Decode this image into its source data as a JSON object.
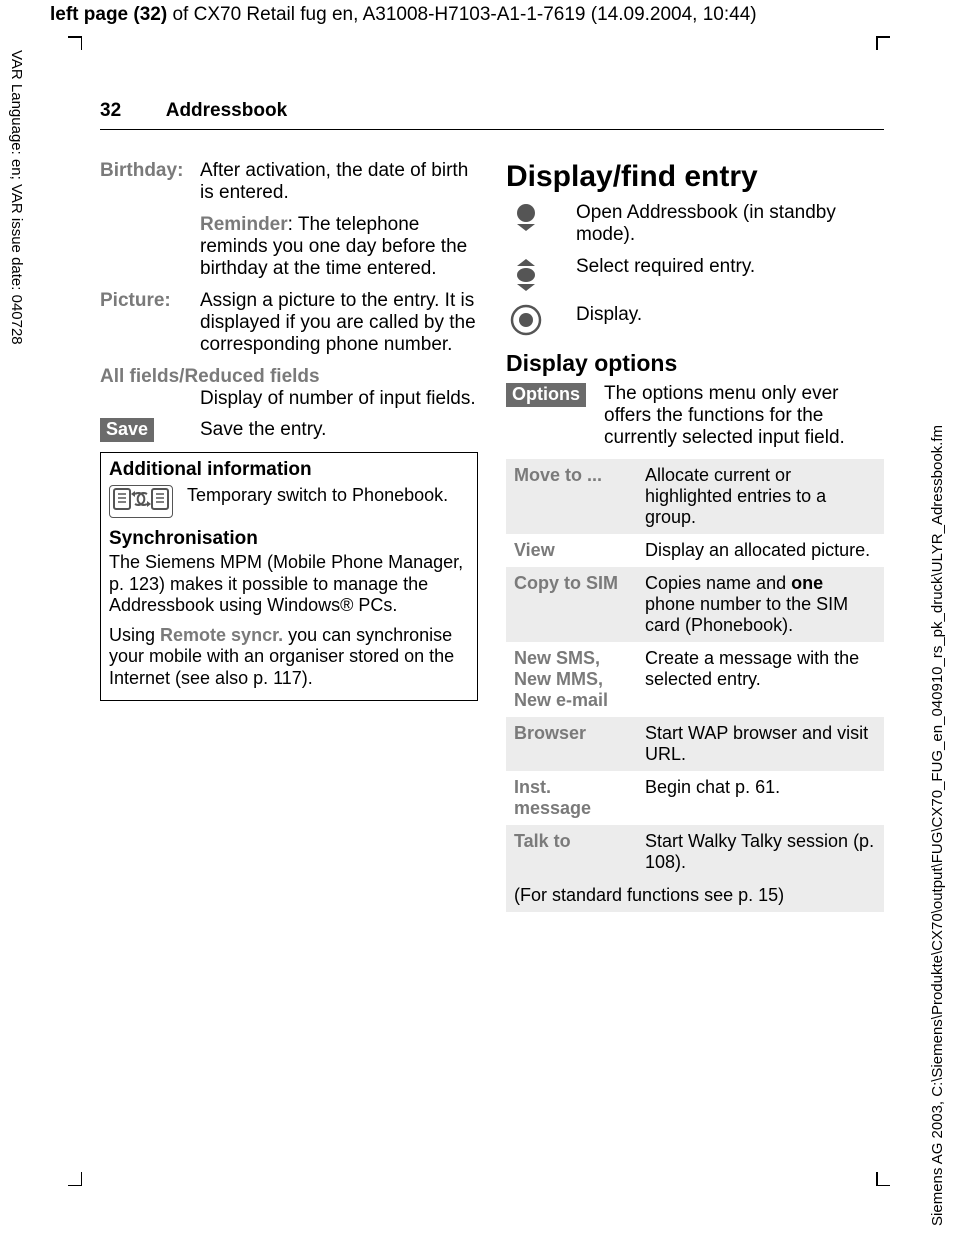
{
  "meta": {
    "top_header_bold": "left page (32)",
    "top_header_rest": " of CX70 Retail fug en, A31008-H7103-A1-1-7619 (14.09.2004, 10:44)",
    "left_margin": "VAR Language: en; VAR issue date: 040728",
    "right_margin": "Siemens AG 2003, C:\\Siemens\\Produkte\\CX70\\output\\FUG\\CX70_FUG_en_040910_rs_pk_druck\\ULYR_Adressbook.fm"
  },
  "header": {
    "page_number": "32",
    "section": "Addressbook"
  },
  "left_col": {
    "birthday_label": "Birthday:",
    "birthday_text1": "After activation, the date of birth is entered.",
    "reminder_label": "Reminder",
    "reminder_text": ": The telephone reminds you one day before the birthday at the time entered.",
    "picture_label": "Picture:",
    "picture_text": "Assign a picture to the entry. It is displayed if you are called by the corresponding phone number.",
    "allfields_label": "All fields/Reduced fields",
    "allfields_text": "Display of number of input fields.",
    "save_key": "Save",
    "save_text": "Save the entry.",
    "box": {
      "title": "Additional information",
      "icon_text": "⿴↻⿴",
      "switch_text": "Temporary switch to Phonebook.",
      "sync_title": "Synchronisation",
      "sync_p1_a": "The Siemens MPM (Mobile Phone Manager, p. 123) makes it possible to manage the Addressbook using Windows® PCs.",
      "sync_p2_a": "Using ",
      "sync_p2_bold": "Remote syncr.",
      "sync_p2_b": " you can synchronise your mobile with an organiser stored on the Internet (see also p. 117)."
    }
  },
  "right_col": {
    "h2": "Display/find entry",
    "row1": "Open Addressbook (in standby mode).",
    "row2": "Select required entry.",
    "row3": "Display.",
    "h3": "Display options",
    "options_key": "Options",
    "options_intro": "The options menu only ever offers the functions for the currently selected input field.",
    "table": [
      {
        "label": "Move to ...",
        "desc_a": "Allocate current or highlighted entries to a group."
      },
      {
        "label": "View",
        "desc_a": "Display an allocated picture."
      },
      {
        "label": "Copy to SIM",
        "desc_a": "Copies name and ",
        "bold": "one",
        "desc_b": " phone number to the SIM card (Phonebook)."
      },
      {
        "label": "New SMS, New MMS, New e-mail",
        "desc_a": "Create a message with the selected entry."
      },
      {
        "label": "Browser",
        "desc_a": "Start WAP browser and visit URL."
      },
      {
        "label": "Inst. message",
        "desc_a": "Begin chat p. 61."
      },
      {
        "label": "Talk to",
        "desc_a": "Start Walky Talky session (p. 108)."
      }
    ],
    "footnote": "(For standard functions see p. 15)"
  }
}
